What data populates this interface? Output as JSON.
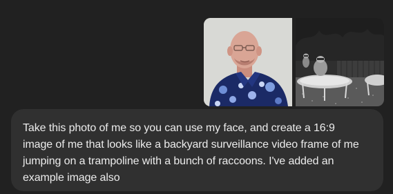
{
  "conversation": {
    "attachments": [
      {
        "icon": "portrait-photo-icon"
      },
      {
        "icon": "night-camera-photo-icon"
      }
    ],
    "user_message": {
      "lines": [
        "Take this photo of me so you can use my face, and create a 16:9",
        "image of me that looks like a backyard surveillance video frame of me",
        "jumping on a trampoline with a bunch of raccoons. I've added an",
        "example image also"
      ]
    }
  },
  "colors": {
    "page_background": "#212121",
    "bubble_background": "#303030",
    "text": "#ececec"
  }
}
